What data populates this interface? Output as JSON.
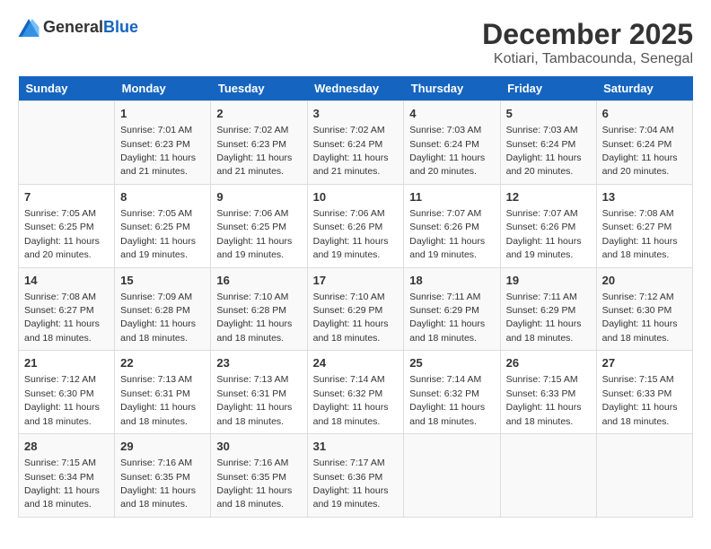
{
  "logo": {
    "general": "General",
    "blue": "Blue"
  },
  "title": "December 2025",
  "subtitle": "Kotiari, Tambacounda, Senegal",
  "weekdays": [
    "Sunday",
    "Monday",
    "Tuesday",
    "Wednesday",
    "Thursday",
    "Friday",
    "Saturday"
  ],
  "weeks": [
    [
      {
        "day": "",
        "sunrise": "",
        "sunset": "",
        "daylight": ""
      },
      {
        "day": "1",
        "sunrise": "Sunrise: 7:01 AM",
        "sunset": "Sunset: 6:23 PM",
        "daylight": "Daylight: 11 hours and 21 minutes."
      },
      {
        "day": "2",
        "sunrise": "Sunrise: 7:02 AM",
        "sunset": "Sunset: 6:23 PM",
        "daylight": "Daylight: 11 hours and 21 minutes."
      },
      {
        "day": "3",
        "sunrise": "Sunrise: 7:02 AM",
        "sunset": "Sunset: 6:24 PM",
        "daylight": "Daylight: 11 hours and 21 minutes."
      },
      {
        "day": "4",
        "sunrise": "Sunrise: 7:03 AM",
        "sunset": "Sunset: 6:24 PM",
        "daylight": "Daylight: 11 hours and 20 minutes."
      },
      {
        "day": "5",
        "sunrise": "Sunrise: 7:03 AM",
        "sunset": "Sunset: 6:24 PM",
        "daylight": "Daylight: 11 hours and 20 minutes."
      },
      {
        "day": "6",
        "sunrise": "Sunrise: 7:04 AM",
        "sunset": "Sunset: 6:24 PM",
        "daylight": "Daylight: 11 hours and 20 minutes."
      }
    ],
    [
      {
        "day": "7",
        "sunrise": "Sunrise: 7:05 AM",
        "sunset": "Sunset: 6:25 PM",
        "daylight": "Daylight: 11 hours and 20 minutes."
      },
      {
        "day": "8",
        "sunrise": "Sunrise: 7:05 AM",
        "sunset": "Sunset: 6:25 PM",
        "daylight": "Daylight: 11 hours and 19 minutes."
      },
      {
        "day": "9",
        "sunrise": "Sunrise: 7:06 AM",
        "sunset": "Sunset: 6:25 PM",
        "daylight": "Daylight: 11 hours and 19 minutes."
      },
      {
        "day": "10",
        "sunrise": "Sunrise: 7:06 AM",
        "sunset": "Sunset: 6:26 PM",
        "daylight": "Daylight: 11 hours and 19 minutes."
      },
      {
        "day": "11",
        "sunrise": "Sunrise: 7:07 AM",
        "sunset": "Sunset: 6:26 PM",
        "daylight": "Daylight: 11 hours and 19 minutes."
      },
      {
        "day": "12",
        "sunrise": "Sunrise: 7:07 AM",
        "sunset": "Sunset: 6:26 PM",
        "daylight": "Daylight: 11 hours and 19 minutes."
      },
      {
        "day": "13",
        "sunrise": "Sunrise: 7:08 AM",
        "sunset": "Sunset: 6:27 PM",
        "daylight": "Daylight: 11 hours and 18 minutes."
      }
    ],
    [
      {
        "day": "14",
        "sunrise": "Sunrise: 7:08 AM",
        "sunset": "Sunset: 6:27 PM",
        "daylight": "Daylight: 11 hours and 18 minutes."
      },
      {
        "day": "15",
        "sunrise": "Sunrise: 7:09 AM",
        "sunset": "Sunset: 6:28 PM",
        "daylight": "Daylight: 11 hours and 18 minutes."
      },
      {
        "day": "16",
        "sunrise": "Sunrise: 7:10 AM",
        "sunset": "Sunset: 6:28 PM",
        "daylight": "Daylight: 11 hours and 18 minutes."
      },
      {
        "day": "17",
        "sunrise": "Sunrise: 7:10 AM",
        "sunset": "Sunset: 6:29 PM",
        "daylight": "Daylight: 11 hours and 18 minutes."
      },
      {
        "day": "18",
        "sunrise": "Sunrise: 7:11 AM",
        "sunset": "Sunset: 6:29 PM",
        "daylight": "Daylight: 11 hours and 18 minutes."
      },
      {
        "day": "19",
        "sunrise": "Sunrise: 7:11 AM",
        "sunset": "Sunset: 6:29 PM",
        "daylight": "Daylight: 11 hours and 18 minutes."
      },
      {
        "day": "20",
        "sunrise": "Sunrise: 7:12 AM",
        "sunset": "Sunset: 6:30 PM",
        "daylight": "Daylight: 11 hours and 18 minutes."
      }
    ],
    [
      {
        "day": "21",
        "sunrise": "Sunrise: 7:12 AM",
        "sunset": "Sunset: 6:30 PM",
        "daylight": "Daylight: 11 hours and 18 minutes."
      },
      {
        "day": "22",
        "sunrise": "Sunrise: 7:13 AM",
        "sunset": "Sunset: 6:31 PM",
        "daylight": "Daylight: 11 hours and 18 minutes."
      },
      {
        "day": "23",
        "sunrise": "Sunrise: 7:13 AM",
        "sunset": "Sunset: 6:31 PM",
        "daylight": "Daylight: 11 hours and 18 minutes."
      },
      {
        "day": "24",
        "sunrise": "Sunrise: 7:14 AM",
        "sunset": "Sunset: 6:32 PM",
        "daylight": "Daylight: 11 hours and 18 minutes."
      },
      {
        "day": "25",
        "sunrise": "Sunrise: 7:14 AM",
        "sunset": "Sunset: 6:32 PM",
        "daylight": "Daylight: 11 hours and 18 minutes."
      },
      {
        "day": "26",
        "sunrise": "Sunrise: 7:15 AM",
        "sunset": "Sunset: 6:33 PM",
        "daylight": "Daylight: 11 hours and 18 minutes."
      },
      {
        "day": "27",
        "sunrise": "Sunrise: 7:15 AM",
        "sunset": "Sunset: 6:33 PM",
        "daylight": "Daylight: 11 hours and 18 minutes."
      }
    ],
    [
      {
        "day": "28",
        "sunrise": "Sunrise: 7:15 AM",
        "sunset": "Sunset: 6:34 PM",
        "daylight": "Daylight: 11 hours and 18 minutes."
      },
      {
        "day": "29",
        "sunrise": "Sunrise: 7:16 AM",
        "sunset": "Sunset: 6:35 PM",
        "daylight": "Daylight: 11 hours and 18 minutes."
      },
      {
        "day": "30",
        "sunrise": "Sunrise: 7:16 AM",
        "sunset": "Sunset: 6:35 PM",
        "daylight": "Daylight: 11 hours and 18 minutes."
      },
      {
        "day": "31",
        "sunrise": "Sunrise: 7:17 AM",
        "sunset": "Sunset: 6:36 PM",
        "daylight": "Daylight: 11 hours and 19 minutes."
      },
      {
        "day": "",
        "sunrise": "",
        "sunset": "",
        "daylight": ""
      },
      {
        "day": "",
        "sunrise": "",
        "sunset": "",
        "daylight": ""
      },
      {
        "day": "",
        "sunrise": "",
        "sunset": "",
        "daylight": ""
      }
    ]
  ]
}
